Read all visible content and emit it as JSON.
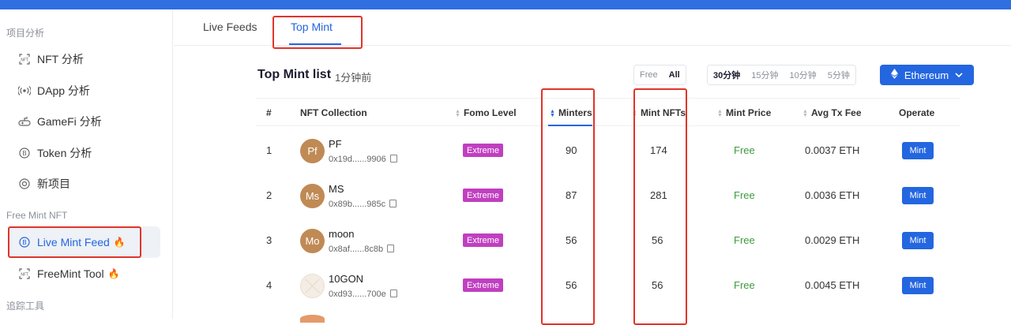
{
  "sidebar": {
    "section1": "项目分析",
    "items1": [
      {
        "label": "NFT 分析",
        "icon": "nft-icon"
      },
      {
        "label": "DApp 分析",
        "icon": "radio-signal-icon"
      },
      {
        "label": "GameFi 分析",
        "icon": "gamepad-icon"
      },
      {
        "label": "Token 分析",
        "icon": "token-coin-icon"
      },
      {
        "label": "新项目",
        "icon": "new-project-icon"
      }
    ],
    "section2": "Free Mint NFT",
    "items2": [
      {
        "label": "Live Mint Feed",
        "icon": "coin-icon",
        "suffix": "🔥",
        "active": true
      },
      {
        "label": "FreeMint Tool",
        "icon": "nft-icon",
        "suffix": "🔥"
      }
    ],
    "section3": "追踪工具"
  },
  "tabs": [
    {
      "label": "Live Feeds"
    },
    {
      "label": "Top Mint",
      "active": true
    }
  ],
  "list": {
    "title": "Top Mint list",
    "subtitle": "1分钟前"
  },
  "filters": {
    "price": [
      "Free",
      "All"
    ],
    "price_selected": "All",
    "time": [
      "30分钟",
      "15分钟",
      "10分钟",
      "5分钟"
    ],
    "time_selected": "30分钟"
  },
  "chain": {
    "label": "Ethereum",
    "icon": "ethereum-icon"
  },
  "columns": [
    "#",
    "NFT Collection",
    "Fomo Level",
    "Minters",
    "Mint NFTs",
    "Mint Price",
    "Avg Tx Fee",
    "Operate"
  ],
  "rows": [
    {
      "rank": "1",
      "avatar": "Pf",
      "name": "PF",
      "address": "0x19d......9906",
      "fomo": "Extreme",
      "minters": "90",
      "mint_nfts": "174",
      "price": "Free",
      "fee": "0.0037 ETH",
      "action": "Mint"
    },
    {
      "rank": "2",
      "avatar": "Ms",
      "name": "MS",
      "address": "0x89b......985c",
      "fomo": "Extreme",
      "minters": "87",
      "mint_nfts": "281",
      "price": "Free",
      "fee": "0.0036 ETH",
      "action": "Mint"
    },
    {
      "rank": "3",
      "avatar": "Mo",
      "name": "moon",
      "address": "0x8af......8c8b",
      "fomo": "Extreme",
      "minters": "56",
      "mint_nfts": "56",
      "price": "Free",
      "fee": "0.0029 ETH",
      "action": "Mint"
    },
    {
      "rank": "4",
      "avatar": "",
      "name": "10GON",
      "address": "0xd93......700e",
      "fomo": "Extreme",
      "minters": "56",
      "mint_nfts": "56",
      "price": "Free",
      "fee": "0.0045 ETH",
      "action": "Mint"
    }
  ],
  "colors": {
    "accent": "#2366e0",
    "extreme": "#c03fc0",
    "free": "#3c9a3c",
    "highlight": "#e0342a"
  }
}
